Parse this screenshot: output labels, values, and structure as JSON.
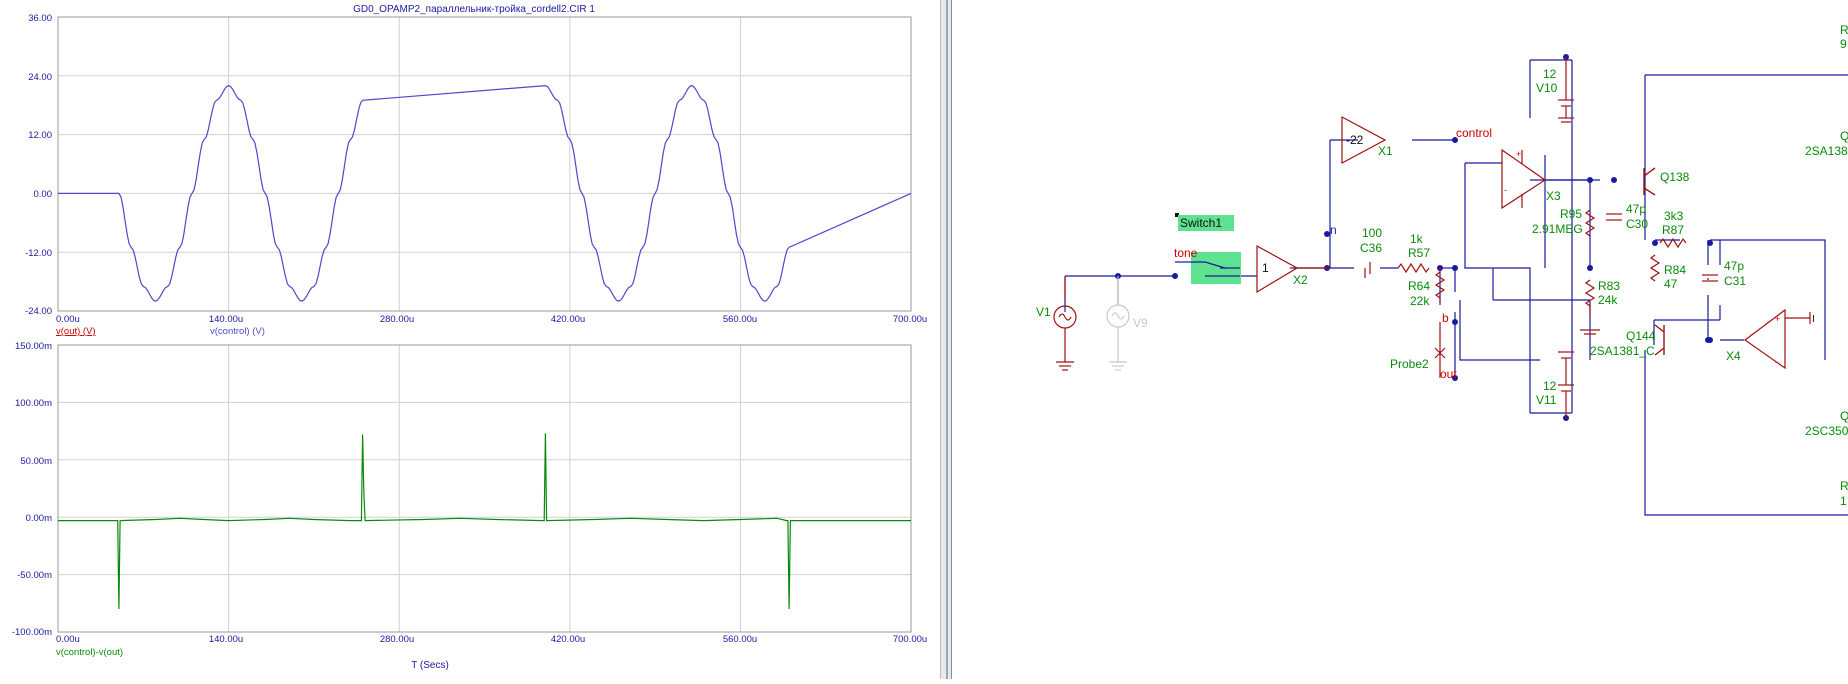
{
  "plot": {
    "title": "GD0_OPAMP2_параллельник-тройка_cordell2.CIR 1",
    "x_axis_label": "T (Secs)",
    "x_ticks": [
      "0.00u",
      "140.00u",
      "280.00u",
      "420.00u",
      "560.00u",
      "700.00u"
    ],
    "top": {
      "y_ticks": [
        "36.00",
        "24.00",
        "12.00",
        "0.00",
        "-12.00",
        "-24.00"
      ],
      "legend": [
        {
          "label": "v(out) (V)",
          "color": "#cc0000"
        },
        {
          "label": "v(control) (V)",
          "color": "#4a4acc"
        }
      ]
    },
    "bottom": {
      "y_ticks": [
        "150.00m",
        "100.00m",
        "50.00m",
        "0.00m",
        "-50.00m",
        "-100.00m"
      ],
      "legend": [
        {
          "label": "v(control)-v(out)",
          "color": "#0a8a0a"
        }
      ]
    }
  },
  "chart_data": [
    {
      "type": "line",
      "title": "GD0_OPAMP2_параллельник-тройка_cordell2.CIR 1",
      "xlabel": "",
      "ylabel": "",
      "xlim": [
        0,
        700
      ],
      "ylim": [
        -24,
        36
      ],
      "series": [
        {
          "name": "v(control) (V)",
          "color": "#4a4acc",
          "x": [
            0,
            50,
            60,
            70,
            80,
            90,
            100,
            110,
            120,
            130,
            140,
            150,
            160,
            170,
            180,
            190,
            200,
            210,
            220,
            230,
            240,
            250,
            400,
            410,
            420,
            430,
            440,
            450,
            460,
            470,
            480,
            490,
            500,
            510,
            520,
            530,
            540,
            550,
            560,
            570,
            580,
            590,
            600,
            700
          ],
          "y": [
            0,
            0,
            -11,
            -19,
            -22,
            -19,
            -11,
            0,
            11,
            19,
            22,
            19,
            11,
            0,
            -11,
            -19,
            -22,
            -19,
            -11,
            0,
            11,
            19,
            22,
            19,
            11,
            0,
            -11,
            -19,
            -22,
            -19,
            -11,
            0,
            11,
            19,
            22,
            19,
            11,
            0,
            -11,
            -19,
            -22,
            -19,
            -11,
            0
          ]
        }
      ]
    },
    {
      "type": "line",
      "title": "",
      "xlabel": "T (Secs)",
      "ylabel": "",
      "xlim": [
        0,
        700
      ],
      "ylim": [
        -100,
        150
      ],
      "series": [
        {
          "name": "v(control)-v(out)",
          "color": "#0a8a0a",
          "x": [
            0,
            49,
            50,
            51,
            80,
            100,
            120,
            140,
            170,
            190,
            210,
            240,
            249,
            250,
            251,
            252,
            300,
            330,
            360,
            398,
            399,
            400,
            401,
            440,
            470,
            500,
            530,
            560,
            590,
            598,
            599,
            600,
            601,
            700
          ],
          "y": [
            -3,
            -3,
            -80,
            -3,
            -2,
            -1,
            -2,
            -3,
            -2,
            -1,
            -2,
            -3,
            -3,
            72,
            20,
            -3,
            -2,
            -1,
            -2,
            -3,
            -3,
            73,
            -3,
            -2,
            -1,
            -2,
            -3,
            -2,
            -1,
            -3,
            -3,
            -80,
            -3,
            -3
          ]
        }
      ]
    }
  ],
  "schematic": {
    "labels": {
      "switch": "Switch1",
      "tone": "tone",
      "v1": "V1",
      "v9": "V9",
      "x2_gain": "1",
      "x2": "X2",
      "x1_gain": "-22",
      "x1": "X1",
      "control": "control",
      "n": "n",
      "c36_val": "100",
      "c36": "C36",
      "r57_val": "1k",
      "r57": "R57",
      "r64": "R64",
      "r64_val": "22k",
      "b": "b",
      "probe2": "Probe2",
      "out": "out",
      "v10_val": "12",
      "v10": "V10",
      "v11_val": "12",
      "v11": "V11",
      "x3": "X3",
      "r95": "R95",
      "r95_val": "2.91MEG",
      "c30_val": "47p",
      "c30": "C30",
      "r83": "R83",
      "r83_val": "24k",
      "q138": "Q138",
      "r87_val": "3k3",
      "r87": "R87",
      "r84": "R84",
      "r84_val": "47",
      "c31_val": "47p",
      "c31": "C31",
      "q144": "Q144",
      "q144_part": "2SA1381_C",
      "x4": "X4",
      "r_top_clip": "R",
      "r_top_clip_val": "9",
      "part_2sa138": "2SA138",
      "q_clip_1": "Q",
      "q_clip_2": "Q",
      "part_2sc350": "2SC350",
      "r_bot_clip": "R",
      "r_bot_clip_val": "1",
      "x4_pin": "I"
    }
  }
}
